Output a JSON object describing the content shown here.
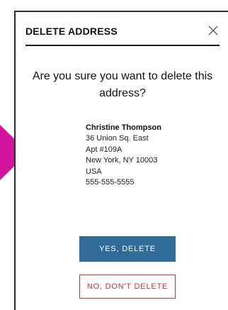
{
  "modal": {
    "title": "DELETE ADDRESS",
    "close_icon": "close-icon",
    "question": "Are you sure you want to delete this address?"
  },
  "address": {
    "name": "Christine Thompson",
    "line1": "36 Union Sq. East",
    "line2": "Apt #109A",
    "city_state_zip": "New York, NY 10003",
    "country": "USA",
    "phone": "555-555-5555"
  },
  "actions": {
    "confirm_label": "YES, DELETE",
    "cancel_label": "NO, DON'T DELETE"
  },
  "colors": {
    "pointer_arrow": "#d3149c",
    "confirm_button": "#2f6c9a",
    "cancel_button": "#c0392b"
  }
}
